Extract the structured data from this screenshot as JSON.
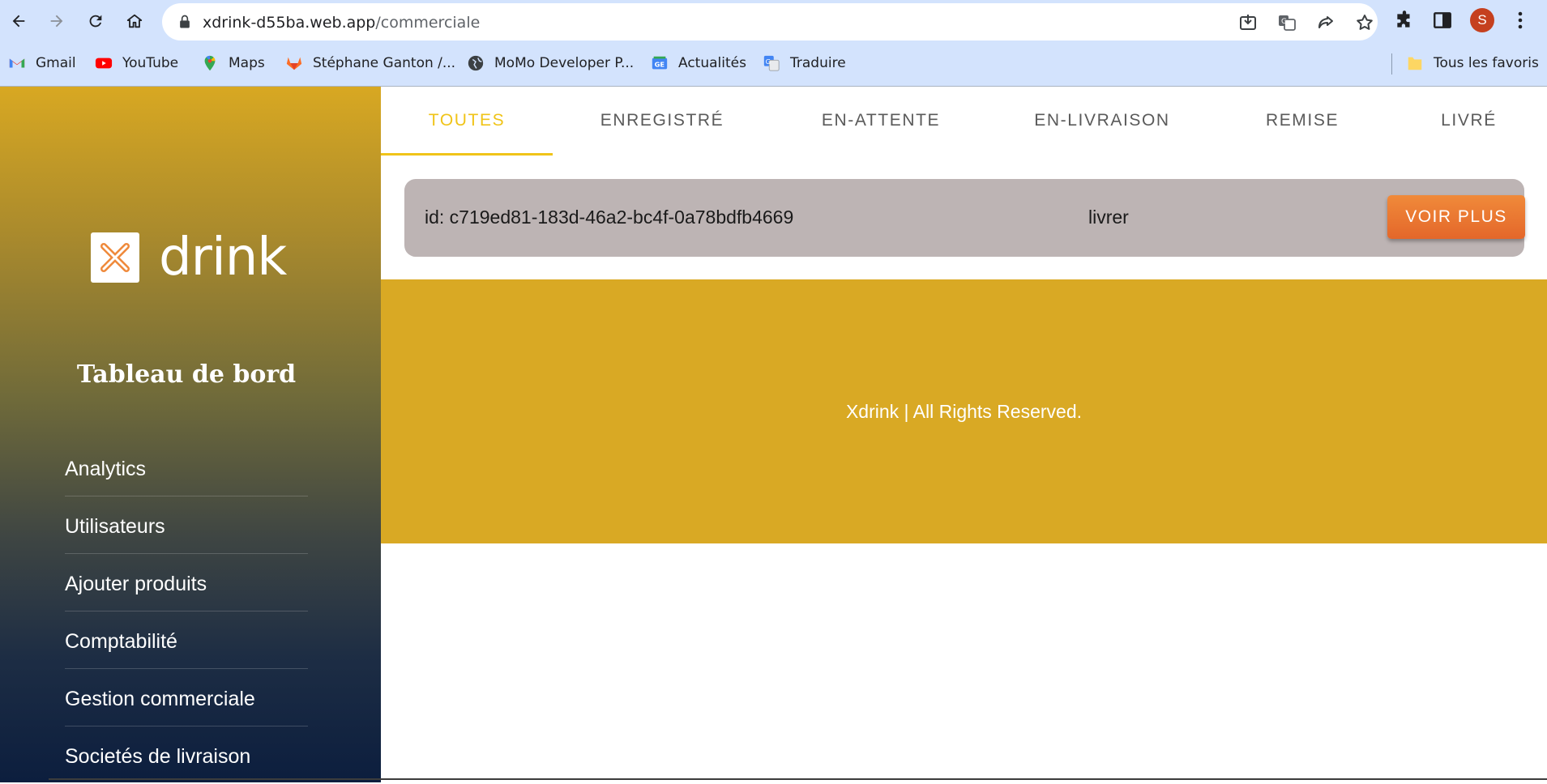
{
  "browser": {
    "url_host": "xdrink-d55ba.web.app",
    "url_path": "/commerciale",
    "profile_initial": "S",
    "bookmarks": [
      {
        "label": "Gmail",
        "icon": "gmail-icon"
      },
      {
        "label": "YouTube",
        "icon": "youtube-icon"
      },
      {
        "label": "Maps",
        "icon": "maps-icon"
      },
      {
        "label": "Stéphane Ganton /...",
        "icon": "gitlab-icon"
      },
      {
        "label": "MoMo Developer P...",
        "icon": "globe-icon"
      },
      {
        "label": "Actualités",
        "icon": "news-icon"
      },
      {
        "label": "Traduire",
        "icon": "translate-icon"
      }
    ],
    "all_bookmarks_label": "Tous les favoris"
  },
  "sidebar": {
    "logo_text": "drink",
    "title": "Tableau de bord",
    "items": [
      {
        "label": "Analytics"
      },
      {
        "label": "Utilisateurs"
      },
      {
        "label": "Ajouter produits"
      },
      {
        "label": "Comptabilité"
      },
      {
        "label": "Gestion commerciale"
      },
      {
        "label": "Societés de livraison"
      }
    ]
  },
  "tabs": [
    {
      "label": "TOUTES",
      "active": true
    },
    {
      "label": "ENREGISTRÉ",
      "active": false
    },
    {
      "label": "EN-ATTENTE",
      "active": false
    },
    {
      "label": "EN-LIVRAISON",
      "active": false
    },
    {
      "label": "REMISE",
      "active": false
    },
    {
      "label": "LIVRÉ",
      "active": false
    }
  ],
  "order": {
    "id_text": "id: c719ed81-183d-46a2-bc4f-0a78bdfb4669",
    "status": "livrer",
    "button_label": "VOIR PLUS"
  },
  "footer": {
    "text": "Xdrink | All Rights Reserved."
  },
  "colors": {
    "accent": "#f0c419",
    "footer_bg": "#d9a924",
    "card_bg": "#bdb4b4",
    "button": "#e9742f",
    "chrome_bg": "#d3e3fd"
  }
}
